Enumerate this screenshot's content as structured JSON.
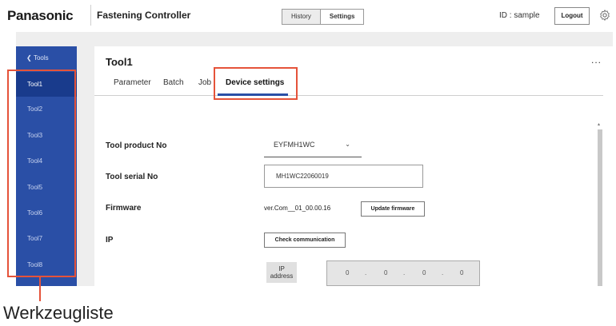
{
  "header": {
    "brand": "Panasonic",
    "app_title": "Fastening Controller",
    "tabs": [
      "History",
      "Settings"
    ],
    "active_tab": "Settings",
    "user_id": "ID : sample",
    "logout_label": "Logout"
  },
  "sidebar": {
    "back_label": "Tools",
    "items": [
      "Tool1",
      "Tool2",
      "Tool3",
      "Tool4",
      "Tool5",
      "Tool6",
      "Tool7",
      "Tool8"
    ],
    "active_item": "Tool1"
  },
  "main": {
    "title": "Tool1",
    "more_label": "...",
    "subtabs": [
      "Parameter",
      "Batch",
      "Job",
      "Device settings"
    ],
    "active_subtab": "Device settings",
    "fields": {
      "product_no_label": "Tool product No",
      "product_no_value": "EYFMH1WC",
      "serial_no_label": "Tool serial No",
      "serial_no_value": "MH1WC22060019",
      "firmware_label": "Firmware",
      "firmware_value": "ver.Com__01_00.00.16",
      "update_firmware_label": "Update firmware",
      "ip_label": "IP",
      "check_comm_label": "Check communication",
      "ip_address_label": "IP address",
      "ip_segments": [
        "0",
        "0",
        "0",
        "0"
      ],
      "ip_separator": "."
    }
  },
  "annotation": {
    "caption": "Werkzeugliste",
    "color": "#e5533a"
  },
  "colors": {
    "sidebar": "#2a4fa6",
    "sidebar_active": "#193b8c",
    "accent": "#2a4fa6"
  }
}
